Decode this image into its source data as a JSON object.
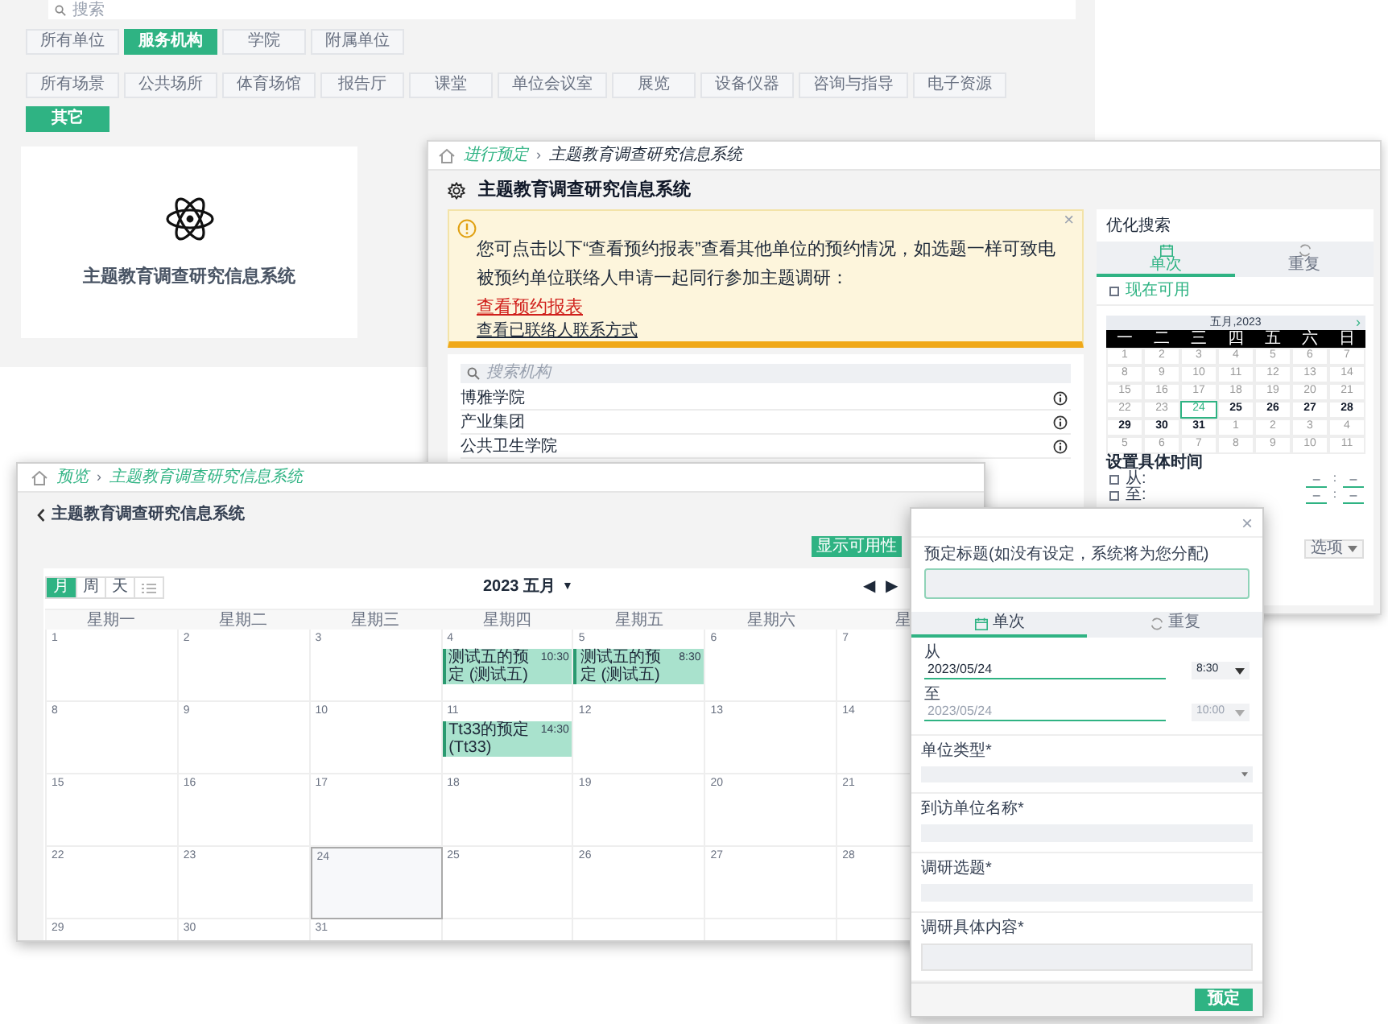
{
  "background_page": {
    "search": {
      "placeholder": "搜索"
    },
    "unit_tabs": [
      {
        "label": "所有单位",
        "selected": false
      },
      {
        "label": "服务机构",
        "selected": true
      },
      {
        "label": "学院",
        "selected": false
      },
      {
        "label": "附属单位",
        "selected": false
      }
    ],
    "scene_tabs": [
      {
        "label": "所有场景",
        "selected": false
      },
      {
        "label": "公共场所",
        "selected": false
      },
      {
        "label": "体育场馆",
        "selected": false
      },
      {
        "label": "报告厅",
        "selected": false
      },
      {
        "label": "课堂",
        "selected": false
      },
      {
        "label": "单位会议室",
        "selected": false
      },
      {
        "label": "展览",
        "selected": false
      },
      {
        "label": "设备仪器",
        "selected": false
      },
      {
        "label": "咨询与指导",
        "selected": false
      },
      {
        "label": "电子资源",
        "selected": false
      },
      {
        "label": "其它",
        "selected": true
      }
    ],
    "card": {
      "title": "主题教育调查研究信息系统"
    }
  },
  "booking_window": {
    "breadcrumb": [
      "进行预定",
      "主题教育调查研究信息系统"
    ],
    "breadcrumb_separator": "›",
    "title": "主题教育调查研究信息系统",
    "alert": {
      "message": "您可点击以下“查看预约报表”查看其他单位的预约情况，如选题一样可致电被预约单位联络人申请一起同行参加主题调研：",
      "link": "查看预约报表",
      "contact_link": "查看已联络人联系方式",
      "close": "×"
    },
    "search": {
      "placeholder": "搜索机构"
    },
    "units": [
      {
        "name": "博雅学院"
      },
      {
        "name": "产业集团"
      },
      {
        "name": "公共卫生学院"
      }
    ],
    "filter_panel": {
      "title": "优化搜索",
      "tabs": [
        {
          "label": "单次",
          "selected": true
        },
        {
          "label": "重复",
          "selected": false
        }
      ],
      "available_now": {
        "label": "现在可用",
        "checked": false
      },
      "calendar": {
        "month": "五月,2023",
        "next": "›",
        "weekdays": [
          "一",
          "二",
          "三",
          "四",
          "五",
          "六",
          "日"
        ],
        "weeks": [
          [
            {
              "day": "1",
              "muted": true,
              "selected": false
            },
            {
              "day": "2",
              "muted": true,
              "selected": false
            },
            {
              "day": "3",
              "muted": true,
              "selected": false
            },
            {
              "day": "4",
              "muted": true,
              "selected": false
            },
            {
              "day": "5",
              "muted": true,
              "selected": false
            },
            {
              "day": "6",
              "muted": true,
              "selected": false
            },
            {
              "day": "7",
              "muted": true,
              "selected": false
            }
          ],
          [
            {
              "day": "8",
              "muted": true,
              "selected": false
            },
            {
              "day": "9",
              "muted": true,
              "selected": false
            },
            {
              "day": "10",
              "muted": true,
              "selected": false
            },
            {
              "day": "11",
              "muted": true,
              "selected": false
            },
            {
              "day": "12",
              "muted": true,
              "selected": false
            },
            {
              "day": "13",
              "muted": true,
              "selected": false
            },
            {
              "day": "14",
              "muted": true,
              "selected": false
            }
          ],
          [
            {
              "day": "15",
              "muted": true,
              "selected": false
            },
            {
              "day": "16",
              "muted": true,
              "selected": false
            },
            {
              "day": "17",
              "muted": true,
              "selected": false
            },
            {
              "day": "18",
              "muted": true,
              "selected": false
            },
            {
              "day": "19",
              "muted": true,
              "selected": false
            },
            {
              "day": "20",
              "muted": true,
              "selected": false
            },
            {
              "day": "21",
              "muted": true,
              "selected": false
            }
          ],
          [
            {
              "day": "22",
              "muted": true,
              "selected": false
            },
            {
              "day": "23",
              "muted": true,
              "selected": false
            },
            {
              "day": "24",
              "muted": false,
              "selected": true
            },
            {
              "day": "25",
              "muted": false,
              "selected": false
            },
            {
              "day": "26",
              "muted": false,
              "selected": false
            },
            {
              "day": "27",
              "muted": false,
              "selected": false
            },
            {
              "day": "28",
              "muted": false,
              "selected": false
            }
          ],
          [
            {
              "day": "29",
              "muted": false,
              "selected": false
            },
            {
              "day": "30",
              "muted": false,
              "selected": false
            },
            {
              "day": "31",
              "muted": false,
              "selected": false
            },
            {
              "day": "1",
              "muted": true,
              "selected": false
            },
            {
              "day": "2",
              "muted": true,
              "selected": false
            },
            {
              "day": "3",
              "muted": true,
              "selected": false
            },
            {
              "day": "4",
              "muted": true,
              "selected": false
            }
          ],
          [
            {
              "day": "5",
              "muted": true,
              "selected": false
            },
            {
              "day": "6",
              "muted": true,
              "selected": false
            },
            {
              "day": "7",
              "muted": true,
              "selected": false
            },
            {
              "day": "8",
              "muted": true,
              "selected": false
            },
            {
              "day": "9",
              "muted": true,
              "selected": false
            },
            {
              "day": "10",
              "muted": true,
              "selected": false
            },
            {
              "day": "11",
              "muted": true,
              "selected": false
            }
          ]
        ]
      },
      "time_heading": "设置具体时间",
      "time_rows": [
        {
          "label": "从:",
          "checked": false,
          "hour": "–",
          "separator": ":",
          "minute": "–"
        },
        {
          "label": "至:",
          "checked": false,
          "hour": "–",
          "separator": ":",
          "minute": "–"
        }
      ],
      "options": "选项"
    }
  },
  "calendar_window": {
    "breadcrumb": [
      "预览",
      "主题教育调查研究信息系统"
    ],
    "breadcrumb_separator": "›",
    "back_title": "主题教育调查研究信息系统",
    "availability_button": "显示可用性",
    "views": [
      {
        "kind": "text",
        "label": "月",
        "selected": true
      },
      {
        "kind": "text",
        "label": "周",
        "selected": false
      },
      {
        "kind": "text",
        "label": "天",
        "selected": false
      },
      {
        "kind": "list",
        "selected": false
      }
    ],
    "month_title": "2023 五月",
    "month_caret": "▼",
    "prev": "◀",
    "next": "▶",
    "weekdays": [
      "星期一",
      "星期二",
      "星期三",
      "星期四",
      "星期五",
      "星期六",
      "星"
    ],
    "weeks": [
      [
        {
          "day": "1",
          "today": false
        },
        {
          "day": "2",
          "today": false
        },
        {
          "day": "3",
          "today": false
        },
        {
          "day": "4",
          "today": false,
          "events": [
            {
              "title": "测试五的预定 (测试五)",
              "time": "10:30"
            }
          ]
        },
        {
          "day": "5",
          "today": false,
          "events": [
            {
              "title": "测试五的预定 (测试五)",
              "time": "8:30"
            }
          ]
        },
        {
          "day": "6",
          "today": false
        },
        {
          "day": "7",
          "today": false
        }
      ],
      [
        {
          "day": "8",
          "today": false
        },
        {
          "day": "9",
          "today": false
        },
        {
          "day": "10",
          "today": false
        },
        {
          "day": "11",
          "today": false,
          "events": [
            {
              "title": "Tt33的预定 (Tt33)",
              "time": "14:30"
            }
          ]
        },
        {
          "day": "12",
          "today": false
        },
        {
          "day": "13",
          "today": false
        },
        {
          "day": "14",
          "today": false
        }
      ],
      [
        {
          "day": "15",
          "today": false
        },
        {
          "day": "16",
          "today": false
        },
        {
          "day": "17",
          "today": false
        },
        {
          "day": "18",
          "today": false
        },
        {
          "day": "19",
          "today": false
        },
        {
          "day": "20",
          "today": false
        },
        {
          "day": "21",
          "today": false
        }
      ],
      [
        {
          "day": "22",
          "today": false
        },
        {
          "day": "23",
          "today": false
        },
        {
          "day": "24",
          "today": true
        },
        {
          "day": "25",
          "today": false
        },
        {
          "day": "26",
          "today": false
        },
        {
          "day": "27",
          "today": false
        },
        {
          "day": "28",
          "today": false
        }
      ],
      [
        {
          "day": "29",
          "today": false
        },
        {
          "day": "30",
          "today": false
        },
        {
          "day": "31",
          "today": false
        }
      ]
    ]
  },
  "booking_dialog": {
    "close": "×",
    "title_label": "预定标题(如没有设定，系统将为您分配)",
    "tabs": [
      {
        "label": "单次",
        "selected": true
      },
      {
        "label": "重复",
        "selected": false
      }
    ],
    "from": {
      "label": "从",
      "date": "2023/05/24",
      "time": "8:30",
      "disabled": false
    },
    "to": {
      "label": "至",
      "date": "2023/05/24",
      "time": "10:00",
      "disabled": true
    },
    "fields": [
      {
        "kind": "select",
        "label": "单位类型*"
      },
      {
        "kind": "input",
        "label": "到访单位名称*"
      },
      {
        "kind": "input",
        "label": "调研选题*"
      },
      {
        "kind": "textarea",
        "label": "调研具体内容*"
      }
    ],
    "submit": "预定"
  }
}
